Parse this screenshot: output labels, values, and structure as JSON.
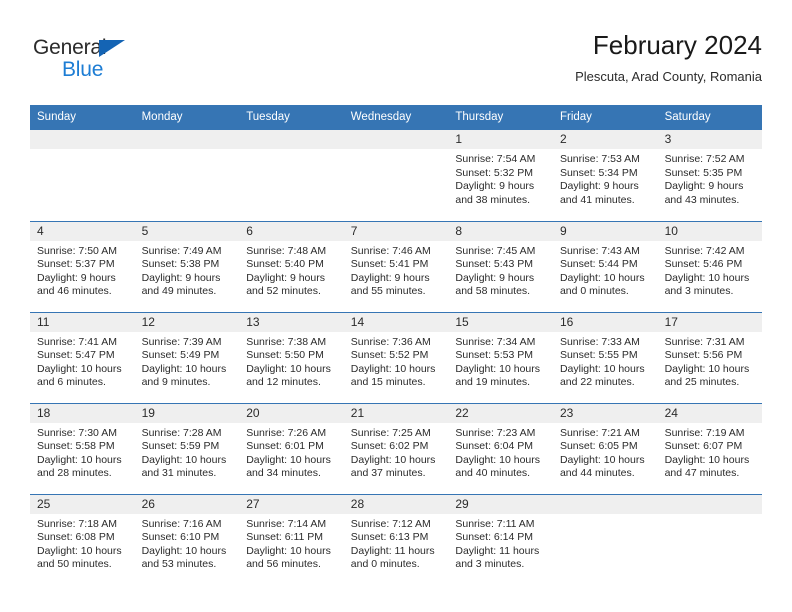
{
  "brand": {
    "name_dark": "General",
    "name_blue": "Blue",
    "triangle_icon": "triangle-logo-icon",
    "accent_color": "#1464b4"
  },
  "header": {
    "title": "February 2024",
    "subtitle": "Plescuta, Arad County, Romania"
  },
  "colors": {
    "header_blue": "#3675b4",
    "daynum_band": "#efefef",
    "text": "#2b2b2b"
  },
  "calendar": {
    "weekday_headers": [
      "Sunday",
      "Monday",
      "Tuesday",
      "Wednesday",
      "Thursday",
      "Friday",
      "Saturday"
    ],
    "weeks": [
      [
        {
          "day": "",
          "lines": []
        },
        {
          "day": "",
          "lines": []
        },
        {
          "day": "",
          "lines": []
        },
        {
          "day": "",
          "lines": []
        },
        {
          "day": "1",
          "lines": [
            "Sunrise: 7:54 AM",
            "Sunset: 5:32 PM",
            "Daylight: 9 hours",
            "and 38 minutes."
          ]
        },
        {
          "day": "2",
          "lines": [
            "Sunrise: 7:53 AM",
            "Sunset: 5:34 PM",
            "Daylight: 9 hours",
            "and 41 minutes."
          ]
        },
        {
          "day": "3",
          "lines": [
            "Sunrise: 7:52 AM",
            "Sunset: 5:35 PM",
            "Daylight: 9 hours",
            "and 43 minutes."
          ]
        }
      ],
      [
        {
          "day": "4",
          "lines": [
            "Sunrise: 7:50 AM",
            "Sunset: 5:37 PM",
            "Daylight: 9 hours",
            "and 46 minutes."
          ]
        },
        {
          "day": "5",
          "lines": [
            "Sunrise: 7:49 AM",
            "Sunset: 5:38 PM",
            "Daylight: 9 hours",
            "and 49 minutes."
          ]
        },
        {
          "day": "6",
          "lines": [
            "Sunrise: 7:48 AM",
            "Sunset: 5:40 PM",
            "Daylight: 9 hours",
            "and 52 minutes."
          ]
        },
        {
          "day": "7",
          "lines": [
            "Sunrise: 7:46 AM",
            "Sunset: 5:41 PM",
            "Daylight: 9 hours",
            "and 55 minutes."
          ]
        },
        {
          "day": "8",
          "lines": [
            "Sunrise: 7:45 AM",
            "Sunset: 5:43 PM",
            "Daylight: 9 hours",
            "and 58 minutes."
          ]
        },
        {
          "day": "9",
          "lines": [
            "Sunrise: 7:43 AM",
            "Sunset: 5:44 PM",
            "Daylight: 10 hours",
            "and 0 minutes."
          ]
        },
        {
          "day": "10",
          "lines": [
            "Sunrise: 7:42 AM",
            "Sunset: 5:46 PM",
            "Daylight: 10 hours",
            "and 3 minutes."
          ]
        }
      ],
      [
        {
          "day": "11",
          "lines": [
            "Sunrise: 7:41 AM",
            "Sunset: 5:47 PM",
            "Daylight: 10 hours",
            "and 6 minutes."
          ]
        },
        {
          "day": "12",
          "lines": [
            "Sunrise: 7:39 AM",
            "Sunset: 5:49 PM",
            "Daylight: 10 hours",
            "and 9 minutes."
          ]
        },
        {
          "day": "13",
          "lines": [
            "Sunrise: 7:38 AM",
            "Sunset: 5:50 PM",
            "Daylight: 10 hours",
            "and 12 minutes."
          ]
        },
        {
          "day": "14",
          "lines": [
            "Sunrise: 7:36 AM",
            "Sunset: 5:52 PM",
            "Daylight: 10 hours",
            "and 15 minutes."
          ]
        },
        {
          "day": "15",
          "lines": [
            "Sunrise: 7:34 AM",
            "Sunset: 5:53 PM",
            "Daylight: 10 hours",
            "and 19 minutes."
          ]
        },
        {
          "day": "16",
          "lines": [
            "Sunrise: 7:33 AM",
            "Sunset: 5:55 PM",
            "Daylight: 10 hours",
            "and 22 minutes."
          ]
        },
        {
          "day": "17",
          "lines": [
            "Sunrise: 7:31 AM",
            "Sunset: 5:56 PM",
            "Daylight: 10 hours",
            "and 25 minutes."
          ]
        }
      ],
      [
        {
          "day": "18",
          "lines": [
            "Sunrise: 7:30 AM",
            "Sunset: 5:58 PM",
            "Daylight: 10 hours",
            "and 28 minutes."
          ]
        },
        {
          "day": "19",
          "lines": [
            "Sunrise: 7:28 AM",
            "Sunset: 5:59 PM",
            "Daylight: 10 hours",
            "and 31 minutes."
          ]
        },
        {
          "day": "20",
          "lines": [
            "Sunrise: 7:26 AM",
            "Sunset: 6:01 PM",
            "Daylight: 10 hours",
            "and 34 minutes."
          ]
        },
        {
          "day": "21",
          "lines": [
            "Sunrise: 7:25 AM",
            "Sunset: 6:02 PM",
            "Daylight: 10 hours",
            "and 37 minutes."
          ]
        },
        {
          "day": "22",
          "lines": [
            "Sunrise: 7:23 AM",
            "Sunset: 6:04 PM",
            "Daylight: 10 hours",
            "and 40 minutes."
          ]
        },
        {
          "day": "23",
          "lines": [
            "Sunrise: 7:21 AM",
            "Sunset: 6:05 PM",
            "Daylight: 10 hours",
            "and 44 minutes."
          ]
        },
        {
          "day": "24",
          "lines": [
            "Sunrise: 7:19 AM",
            "Sunset: 6:07 PM",
            "Daylight: 10 hours",
            "and 47 minutes."
          ]
        }
      ],
      [
        {
          "day": "25",
          "lines": [
            "Sunrise: 7:18 AM",
            "Sunset: 6:08 PM",
            "Daylight: 10 hours",
            "and 50 minutes."
          ]
        },
        {
          "day": "26",
          "lines": [
            "Sunrise: 7:16 AM",
            "Sunset: 6:10 PM",
            "Daylight: 10 hours",
            "and 53 minutes."
          ]
        },
        {
          "day": "27",
          "lines": [
            "Sunrise: 7:14 AM",
            "Sunset: 6:11 PM",
            "Daylight: 10 hours",
            "and 56 minutes."
          ]
        },
        {
          "day": "28",
          "lines": [
            "Sunrise: 7:12 AM",
            "Sunset: 6:13 PM",
            "Daylight: 11 hours",
            "and 0 minutes."
          ]
        },
        {
          "day": "29",
          "lines": [
            "Sunrise: 7:11 AM",
            "Sunset: 6:14 PM",
            "Daylight: 11 hours",
            "and 3 minutes."
          ]
        },
        {
          "day": "",
          "lines": []
        },
        {
          "day": "",
          "lines": []
        }
      ]
    ]
  }
}
